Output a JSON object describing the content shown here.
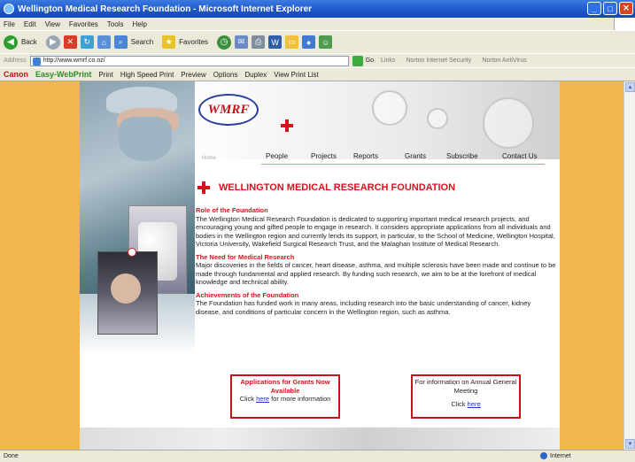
{
  "window": {
    "title": "Wellington Medical Research Foundation - Microsoft Internet Explorer",
    "buttons": [
      "_",
      "□",
      "✕"
    ]
  },
  "menu": {
    "items": [
      "File",
      "Edit",
      "View",
      "Favorites",
      "Tools",
      "Help"
    ]
  },
  "toolbar": {
    "back": "Back",
    "search": "Search",
    "favorites": "Favorites"
  },
  "address": {
    "label": "Address",
    "url": "http://www.wmrf.co.nz/",
    "go": "Go",
    "links": "Links",
    "norton_security": "Norton Internet Security",
    "norton_antivirus": "Norton AntiVirus"
  },
  "canon": {
    "brand": "Canon",
    "product": "Easy-WebPrint",
    "print": "Print",
    "high_speed_print": "High Speed Print",
    "preview": "Preview",
    "options": "Options",
    "duplex": "Duplex",
    "view_print_list": "View Print List"
  },
  "status": {
    "text": "Done",
    "zone": "Internet"
  },
  "site": {
    "logo": "WMRF",
    "home": "Home",
    "nav": [
      "People",
      "Projects",
      "Reports",
      "Grants",
      "Subscribe",
      "Contact Us"
    ],
    "title": "WELLINGTON MEDICAL RESEARCH FOUNDATION",
    "sections": [
      {
        "heading": "Role of the Foundation",
        "body": "The Wellington Medical Research Foundation is dedicated to supporting important medical research projects, and encouraging young and gifted people to engage in research. It considers appropriate applications from all individuals and bodies in the Wellington region and currently lends its support, in particular, to the School of Medicine, Wellington Hospital, Victoria University, Wakefield Surgical Research Trust, and the Malaghan Institute of Medical Research."
      },
      {
        "heading": "The Need for Medical Research",
        "body": "Major discoveries in the fields of cancer, heart disease, asthma, and multiple sclerosis have been made and continue to be made through fundamental and applied research. By funding such research, we aim to be at the forefront of medical knowledge and technical ability."
      },
      {
        "heading": "Achievements of the Foundation",
        "body": "The Foundation has funded work in many areas, including research into the basic understanding of cancer, kidney disease, and conditions of particular concern in the Wellington region, such as asthma."
      }
    ],
    "grants_box": {
      "title": "Applications for Grants Now Available",
      "click": "Click",
      "link": "here",
      "suffix": "for more information"
    },
    "agm_box": {
      "text": "For information on Annual General Meeting",
      "click": "Click",
      "link": "here"
    }
  },
  "colors": {
    "accent_red": "#d6131c",
    "page_bg": "#f1b64e"
  }
}
